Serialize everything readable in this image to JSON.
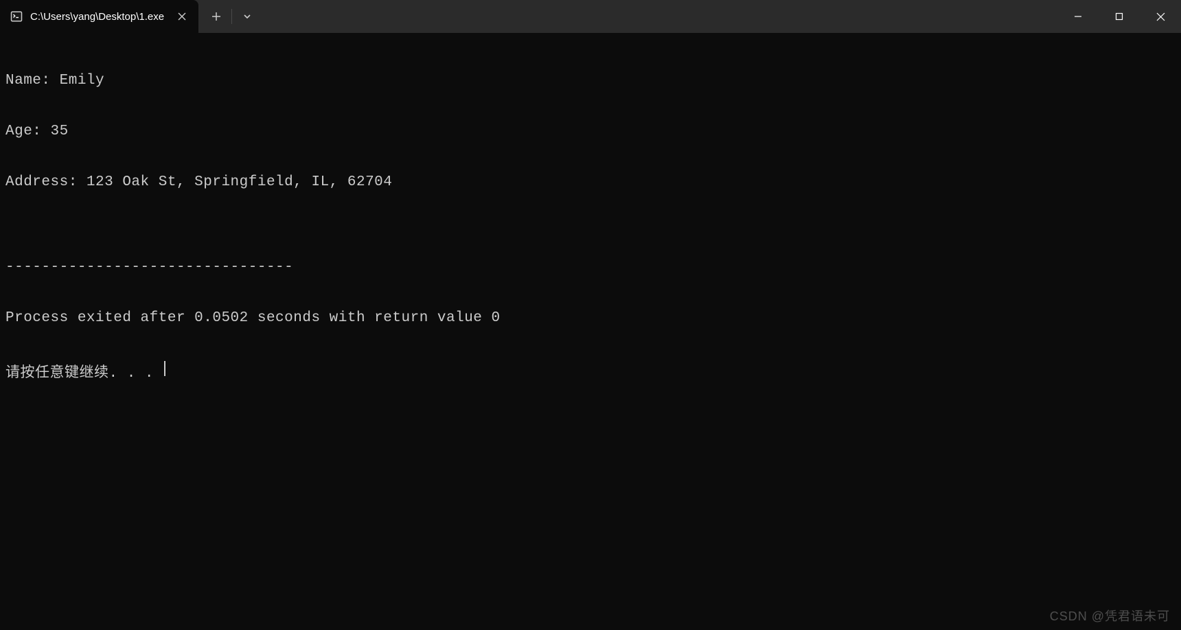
{
  "titlebar": {
    "tab_title": "C:\\Users\\yang\\Desktop\\1.exe"
  },
  "terminal": {
    "lines": [
      "Name: Emily",
      "Age: 35",
      "Address: 123 Oak St, Springfield, IL, 62704",
      "",
      "--------------------------------",
      "Process exited after 0.0502 seconds with return value 0"
    ],
    "prompt": "请按任意键继续. . . "
  },
  "watermark": "CSDN @凭君语未可"
}
